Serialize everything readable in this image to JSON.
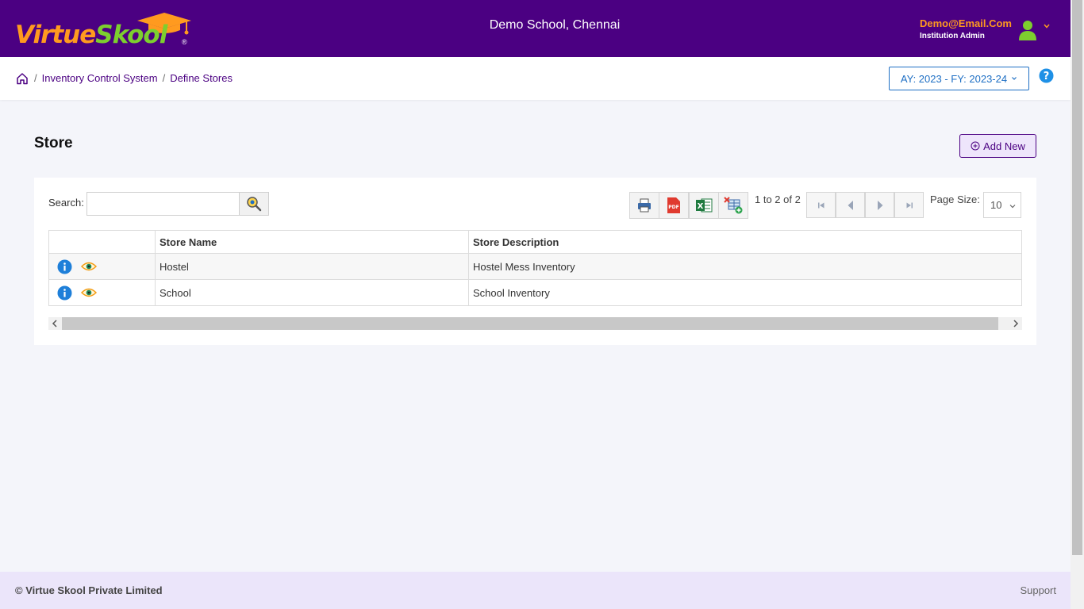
{
  "header": {
    "logo": {
      "part1": "Virtue",
      "part2": "Skool",
      "reg": "®"
    },
    "school_name": "Demo School, Chennai",
    "user": {
      "email": "Demo@Email.Com",
      "role": "Institution Admin"
    }
  },
  "breadcrumb": {
    "items": [
      "Inventory Control System",
      "Define Stores"
    ],
    "separator": "/"
  },
  "year_selector": {
    "label": "AY: 2023 - FY: 2023-24"
  },
  "page": {
    "title": "Store",
    "add_new_label": "Add New"
  },
  "toolbar": {
    "search_label": "Search:",
    "search_value": "",
    "pager_text": "1 to 2 of 2",
    "page_size_label": "Page Size:",
    "page_size_value": "10"
  },
  "table": {
    "columns": [
      "",
      "Store Name",
      "Store Description"
    ],
    "rows": [
      {
        "name": "Hostel",
        "description": "Hostel Mess Inventory"
      },
      {
        "name": "School",
        "description": "School Inventory"
      }
    ]
  },
  "footer": {
    "copyright": "© Virtue Skool Private Limited",
    "support": "Support"
  },
  "colors": {
    "brand": "#4b0082",
    "accent_orange": "#ff9a1f",
    "accent_green": "#7dcf2e",
    "link_blue": "#1e6fc4"
  },
  "icons": [
    "home-icon",
    "chevron-down-icon",
    "help-icon",
    "plus-circle-icon",
    "search-icon",
    "print-icon",
    "pdf-icon",
    "excel-icon",
    "excel-import-icon",
    "first-page-icon",
    "prev-page-icon",
    "next-page-icon",
    "last-page-icon",
    "info-icon",
    "view-icon",
    "user-avatar-icon"
  ]
}
